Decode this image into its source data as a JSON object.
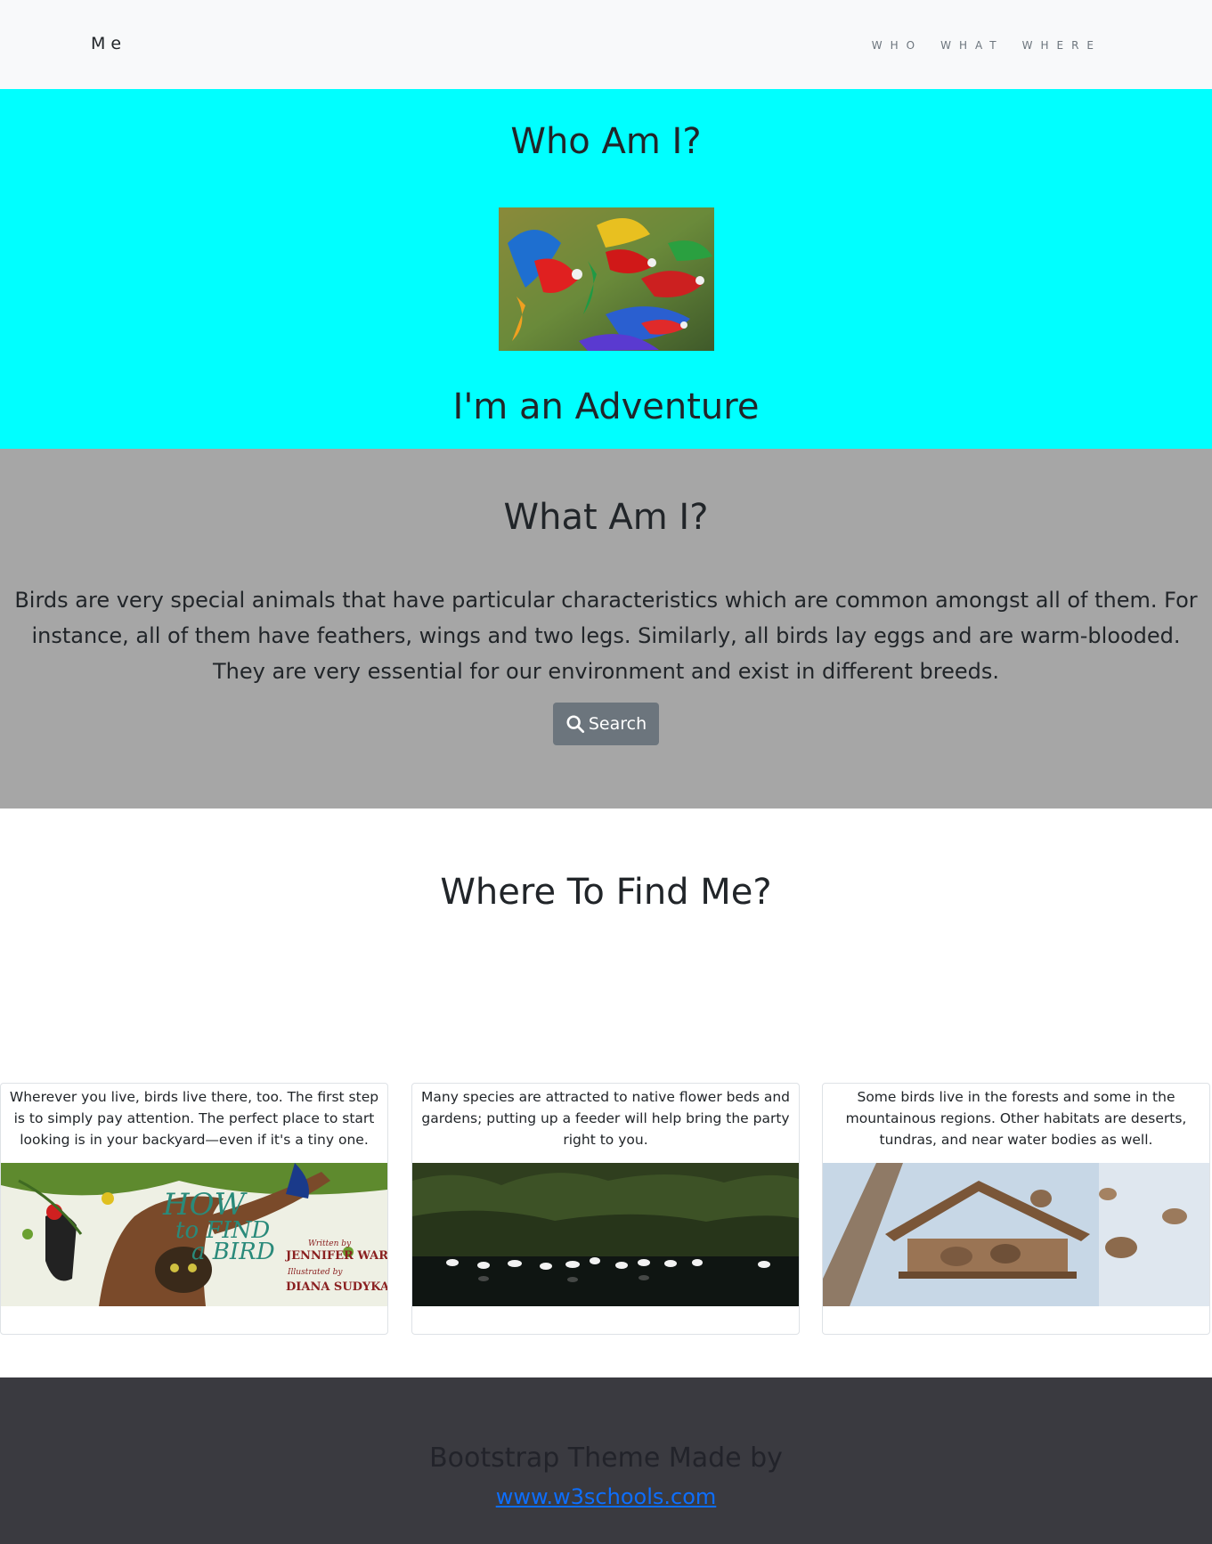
{
  "navbar": {
    "brand": "Me",
    "links": [
      "WHO",
      "WHAT",
      "WHERE"
    ]
  },
  "who": {
    "title": "Who Am I?",
    "subtitle": "I'm an Adventure"
  },
  "what": {
    "title": "What Am I?",
    "paragraph_line1": "Birds are very special animals that have particular characteristics which are common amongst all of them. For instance, all of them have feathers, wings and two legs. Similarly, all birds lay eggs and are warm-blooded.",
    "paragraph_line2": "They are very essential for our environment and exist in different breeds.",
    "search_button": "Search",
    "search_icon": "search-icon"
  },
  "where": {
    "title": "Where To Find Me?",
    "cards": [
      {
        "text": "Wherever you live, birds live there, too. The first step is to simply pay attention. The perfect place to start looking is in your backyard—even if it's a tiny one.",
        "image_lettering": [
          "HOW",
          "to FIND",
          "a BIRD",
          "Written by",
          "JENNIFER WARD",
          "Illustrated by",
          "DIANA SUDYKA"
        ]
      },
      {
        "text": "Many species are attracted to native flower beds and gardens; putting up a feeder will help bring the party right to you."
      },
      {
        "text": "Some birds live in the forests and some in the mountainous regions. Other habitats are deserts, tundras, and near water bodies as well."
      }
    ]
  },
  "footer": {
    "text": "Bootstrap Theme Made by",
    "link": "www.w3schools.com"
  },
  "colors": {
    "who_bg": "#00ffff",
    "what_bg": "#a6a6a6",
    "footer_bg": "#3a3a40",
    "button_bg": "#6c757d",
    "link": "#0d6efd"
  }
}
